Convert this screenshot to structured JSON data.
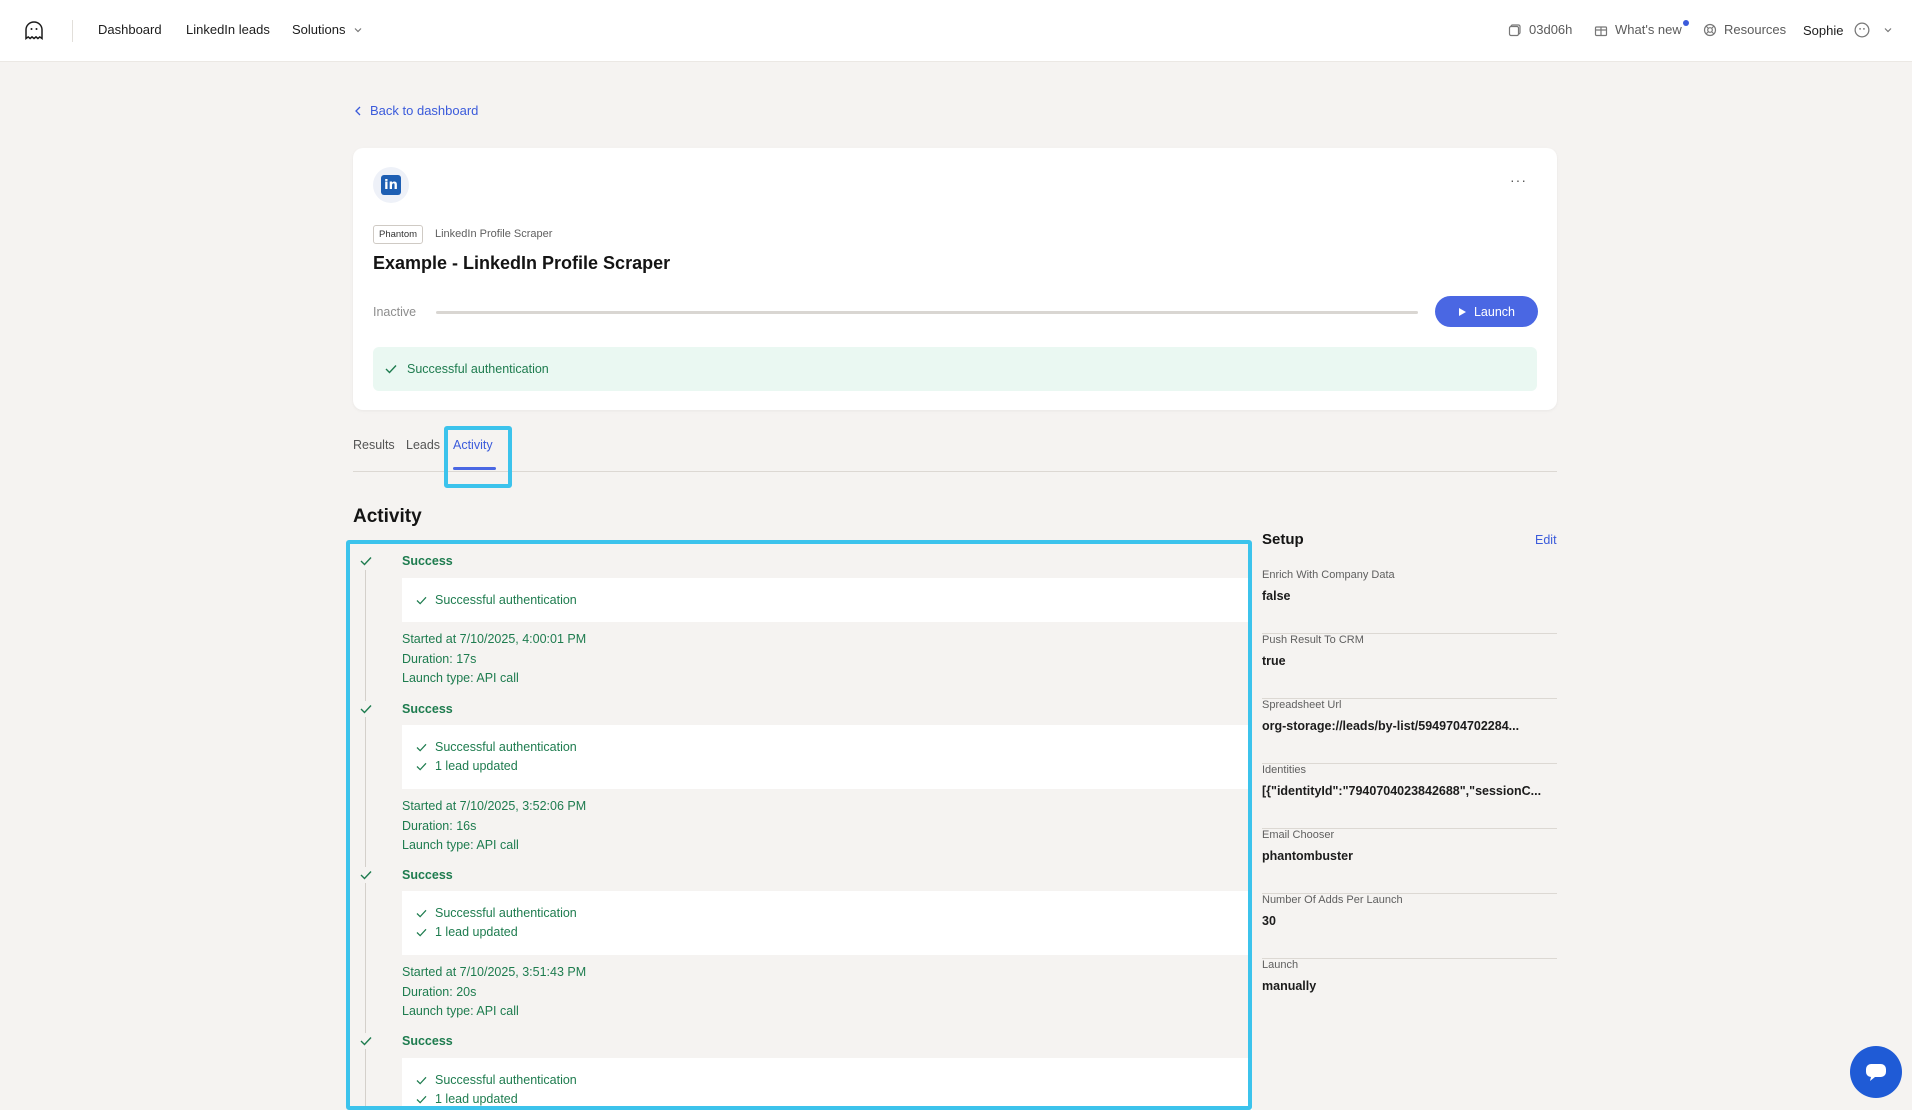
{
  "nav": {
    "links": [
      "Dashboard",
      "LinkedIn leads",
      "Solutions"
    ],
    "time_left": "03d06h",
    "whats_new": "What's new",
    "resources": "Resources",
    "user": "Sophie"
  },
  "back_link": "Back to dashboard",
  "phantom": {
    "tag": "Phantom",
    "type": "LinkedIn Profile Scraper",
    "title": "Example - LinkedIn Profile Scraper",
    "status": "Inactive",
    "progress": 0,
    "launch_label": "Launch",
    "auth_message": "Successful authentication",
    "more_label": "···",
    "logo_letters": "in"
  },
  "tabs": [
    "Results",
    "Leads",
    "Activity"
  ],
  "active_tab": "Activity",
  "activity": {
    "title": "Activity",
    "entries": [
      {
        "status": "Success",
        "messages": [
          "Successful authentication"
        ],
        "started": "Started at 7/10/2025, 4:00:01 PM",
        "duration": "Duration: 17s",
        "launch_type": "Launch type: API call"
      },
      {
        "status": "Success",
        "messages": [
          "Successful authentication",
          "1 lead updated"
        ],
        "started": "Started at 7/10/2025, 3:52:06 PM",
        "duration": "Duration: 16s",
        "launch_type": "Launch type: API call"
      },
      {
        "status": "Success",
        "messages": [
          "Successful authentication",
          "1 lead updated"
        ],
        "started": "Started at 7/10/2025, 3:51:43 PM",
        "duration": "Duration: 20s",
        "launch_type": "Launch type: API call"
      },
      {
        "status": "Success",
        "messages": [
          "Successful authentication",
          "1 lead updated"
        ]
      }
    ]
  },
  "setup": {
    "title": "Setup",
    "edit_label": "Edit",
    "items": [
      {
        "label": "Enrich With Company Data",
        "value": "false"
      },
      {
        "label": "Push Result To CRM",
        "value": "true"
      },
      {
        "label": "Spreadsheet Url",
        "value": "org-storage://leads/by-list/5949704702284..."
      },
      {
        "label": "Identities",
        "value": "[{\"identityId\":\"7940704023842688\",\"sessionC..."
      },
      {
        "label": "Email Chooser",
        "value": "phantombuster"
      },
      {
        "label": "Number Of Adds Per Launch",
        "value": "30"
      },
      {
        "label": "Launch",
        "value": "manually"
      }
    ]
  },
  "colors": {
    "accent": "#4a67e3",
    "success": "#1e7c4f",
    "highlight": "#3cc3ec"
  }
}
